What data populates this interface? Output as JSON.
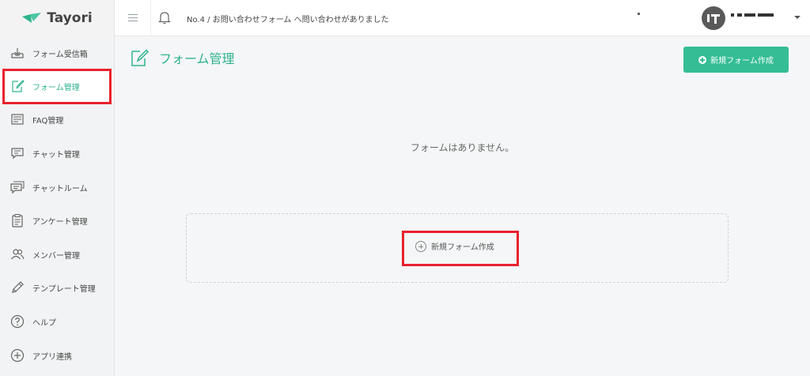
{
  "app": {
    "name": "Tayori"
  },
  "topbar": {
    "notification": "No.4 / お問い合わせフォーム へ問い合わせがありました"
  },
  "sidebar": {
    "items": [
      {
        "label": "フォーム受信箱",
        "icon": "inbox-icon"
      },
      {
        "label": "フォーム管理",
        "icon": "edit-form-icon",
        "active": true
      },
      {
        "label": "FAQ管理",
        "icon": "faq-list-icon"
      },
      {
        "label": "チャット管理",
        "icon": "chat-icon"
      },
      {
        "label": "チャットルーム",
        "icon": "chat-room-icon"
      },
      {
        "label": "アンケート管理",
        "icon": "clipboard-icon"
      },
      {
        "label": "メンバー管理",
        "icon": "members-icon"
      },
      {
        "label": "テンプレート管理",
        "icon": "pencil-icon"
      },
      {
        "label": "ヘルプ",
        "icon": "help-icon"
      },
      {
        "label": "アプリ連携",
        "icon": "plus-circle-icon"
      }
    ]
  },
  "main": {
    "title": "フォーム管理",
    "new_button": "新規フォーム作成",
    "empty_message": "フォームはありません。",
    "create_link": "新規フォーム作成"
  },
  "colors": {
    "accent": "#35bd96",
    "highlight": "#e8222d"
  }
}
